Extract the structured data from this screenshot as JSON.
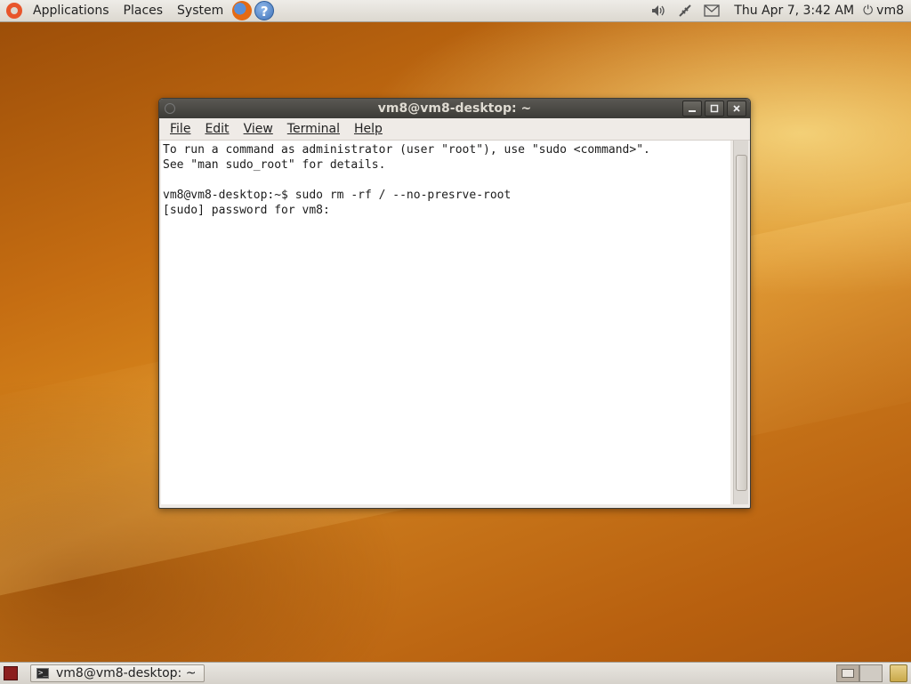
{
  "top_panel": {
    "menus": [
      "Applications",
      "Places",
      "System"
    ],
    "help_glyph": "?",
    "icons": [
      "volume-icon",
      "network-icon",
      "mail-icon"
    ],
    "clock": "Thu Apr  7,  3:42 AM",
    "user": "vm8"
  },
  "window": {
    "title": "vm8@vm8-desktop: ~",
    "buttons": [
      "minimize",
      "maximize",
      "close"
    ],
    "menu": [
      "File",
      "Edit",
      "View",
      "Terminal",
      "Help"
    ],
    "terminal_text": "To run a command as administrator (user \"root\"), use \"sudo <command>\".\nSee \"man sudo_root\" for details.\n\nvm8@vm8-desktop:~$ sudo rm -rf / --no-presrve-root\n[sudo] password for vm8: "
  },
  "bottom_panel": {
    "taskbar_item": "vm8@vm8-desktop: ~"
  },
  "colors": {
    "title_bar": "#3c3b37",
    "desktop_accent": "#d98a1e"
  }
}
